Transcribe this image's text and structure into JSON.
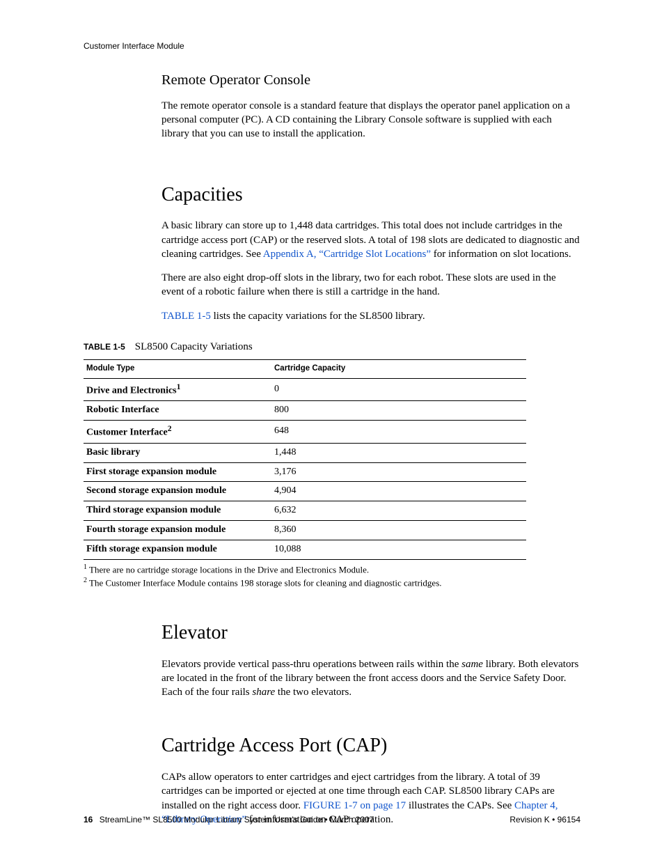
{
  "running_head": "Customer Interface Module",
  "sections": {
    "remote": {
      "title": "Remote Operator Console",
      "p1": "The remote operator console is a standard feature that displays the operator panel application on a personal computer (PC). A CD containing the Library Console software is supplied with each library that you can use to install the application."
    },
    "capacities": {
      "title": "Capacities",
      "p1a": "A basic library can store up to 1,448 data cartridges. This total does not include cartridges in the cartridge access port (CAP) or the reserved slots. A total of 198 slots are dedicated to diagnostic and cleaning cartridges. See ",
      "link1": "Appendix A, “Cartridge Slot Locations”",
      "p1b": " for information on slot locations.",
      "p2": "There are also eight drop-off slots in the library, two for each robot. These slots are used in the event of a robotic failure when there is still a cartridge in the hand.",
      "p3_link": "TABLE 1-5",
      "p3_rest": " lists the capacity variations for the SL8500 library."
    },
    "elevator": {
      "title": "Elevator",
      "p1a": "Elevators provide vertical pass-thru operations between rails within the ",
      "em1": "same",
      "p1b": " library. Both elevators are located in the front of the library between the front access doors and the Service Safety Door. Each of the four rails ",
      "em2": "share",
      "p1c": " the two elevators."
    },
    "cap": {
      "title": "Cartridge Access Port (CAP)",
      "p1a": "CAPs allow operators to enter cartridges and eject cartridges from the library. A total of 39 cartridges can be imported or ejected at one time through each CAP. SL8500 library CAPs are installed on the right access door. ",
      "link1": "FIGURE 1-7 on page 17",
      "p1b": " illustrates the CAPs. See ",
      "link2": "Chapter 4, “Library Operation”",
      "p1c": " for information on CAP operation."
    }
  },
  "table": {
    "label": "TABLE 1-5",
    "title": "SL8500 Capacity Variations",
    "headers": [
      "Module Type",
      "Cartridge Capacity"
    ],
    "rows": [
      {
        "module": "Drive and Electronics",
        "sup": "1",
        "capacity": "0"
      },
      {
        "module": "Robotic Interface",
        "sup": "",
        "capacity": "800"
      },
      {
        "module": "Customer Interface",
        "sup": "2",
        "capacity": "648"
      },
      {
        "module": "Basic library",
        "sup": "",
        "capacity": "1,448"
      },
      {
        "module": "First storage expansion module",
        "sup": "",
        "capacity": "3,176"
      },
      {
        "module": "Second storage expansion module",
        "sup": "",
        "capacity": "4,904"
      },
      {
        "module": "Third storage expansion module",
        "sup": "",
        "capacity": "6,632"
      },
      {
        "module": "Fourth storage expansion module",
        "sup": "",
        "capacity": "8,360"
      },
      {
        "module": "Fifth storage expansion module",
        "sup": "",
        "capacity": "10,088"
      }
    ],
    "footnote1_sup": "1",
    "footnote1": " There are no cartridge storage locations in the Drive and Electronics Module.",
    "footnote2_sup": "2",
    "footnote2": " The Customer Interface Module contains 198 storage slots for cleaning and diagnostic cartridges."
  },
  "footer": {
    "page": "16",
    "left": "StreamLine™ SL8500 Modular Library System User's Guide  •  March 2007",
    "right": "Revision K  •  96154"
  }
}
